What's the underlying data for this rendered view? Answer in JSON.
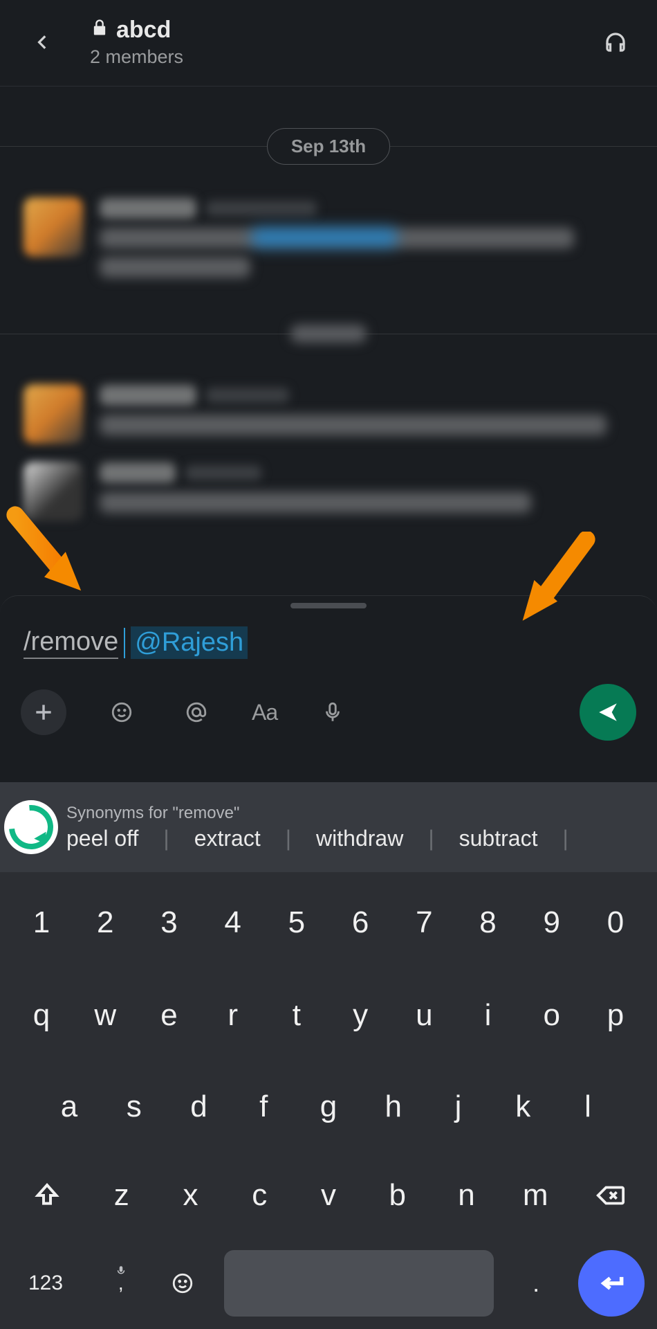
{
  "header": {
    "channel_name": "abcd",
    "subtitle": "2 members"
  },
  "dates": {
    "first": "Sep 13th"
  },
  "composer": {
    "command": "/remove",
    "mention": "@Rajesh"
  },
  "suggestions": {
    "title": "Synonyms for \"remove\"",
    "items": [
      "peel off",
      "extract",
      "withdraw",
      "subtract"
    ]
  },
  "keyboard": {
    "row_num": [
      "1",
      "2",
      "3",
      "4",
      "5",
      "6",
      "7",
      "8",
      "9",
      "0"
    ],
    "row2": [
      "q",
      "w",
      "e",
      "r",
      "t",
      "y",
      "u",
      "i",
      "o",
      "p"
    ],
    "row3": [
      "a",
      "s",
      "d",
      "f",
      "g",
      "h",
      "j",
      "k",
      "l"
    ],
    "row4": [
      "z",
      "x",
      "c",
      "v",
      "b",
      "n",
      "m"
    ],
    "sym_label": "123",
    "comma": ",",
    "period": "."
  }
}
